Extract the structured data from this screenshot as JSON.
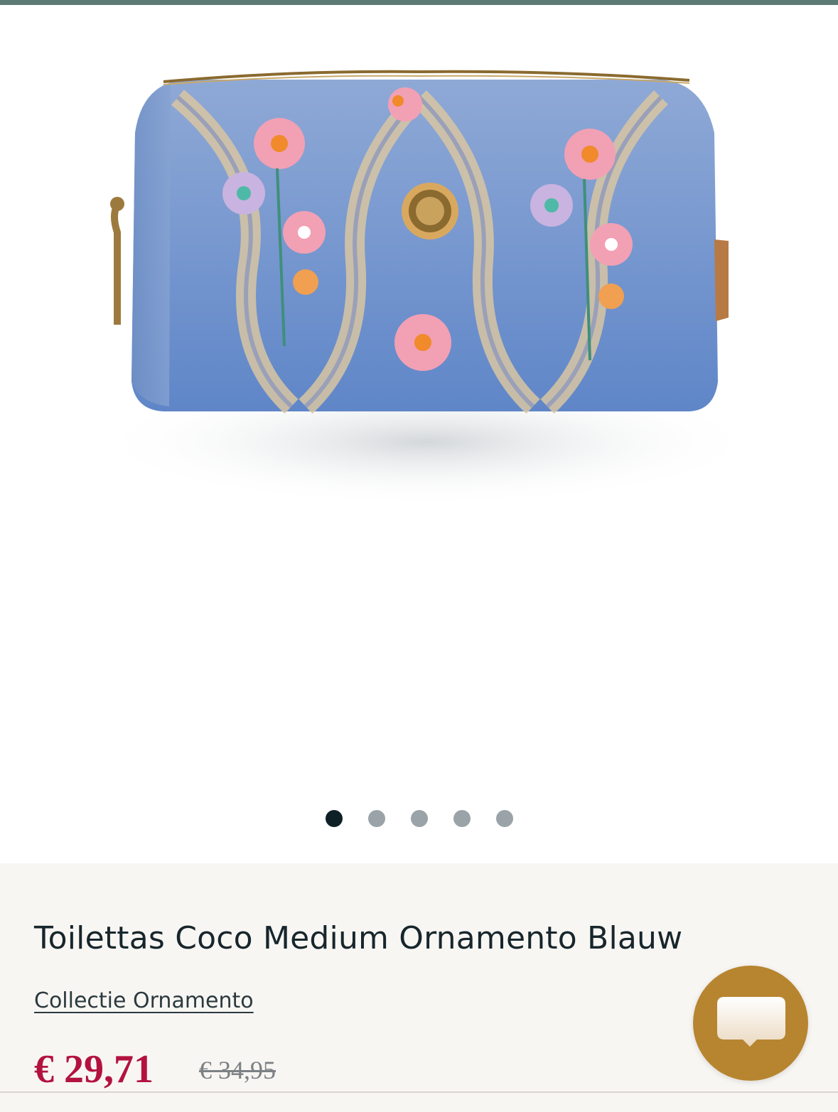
{
  "product": {
    "title": "Toilettas Coco Medium Ornamento Blauw",
    "collection_link": "Collectie Ornamento",
    "price_current": "€ 29,71",
    "price_old": "€ 34,95"
  },
  "gallery": {
    "image_icon": "floral-toiletry-bag-image",
    "slide_count": 5,
    "active_index": 0
  },
  "chat": {
    "icon": "chat-bubble-icon"
  },
  "colors": {
    "top_bar": "#5d7a75",
    "price_sale": "#b3123f",
    "chat_button": "#b7852f",
    "dot_active": "#0f1f26",
    "dot_inactive": "#9aa3a8"
  }
}
